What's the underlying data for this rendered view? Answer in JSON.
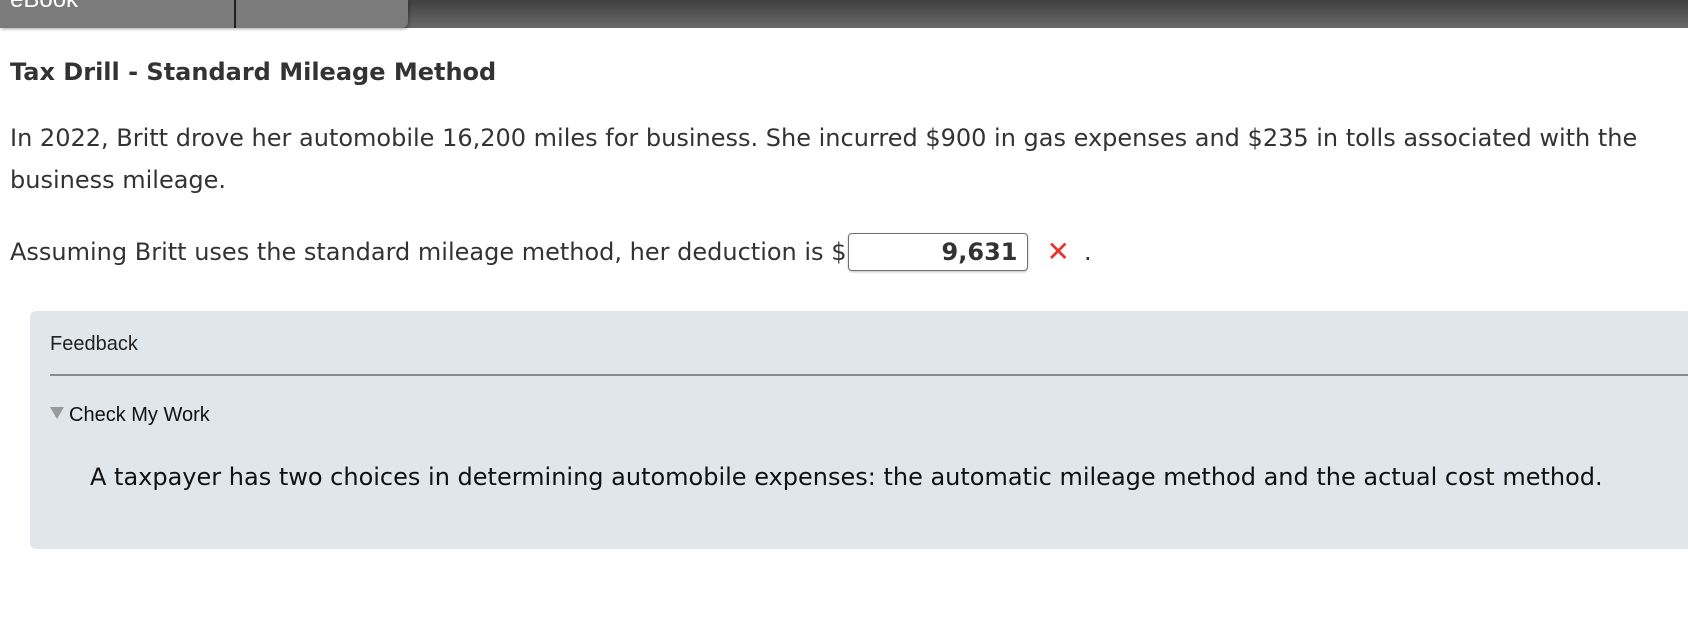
{
  "header": {
    "ebook_label": "eBook"
  },
  "problem": {
    "title": "Tax Drill - Standard Mileage Method",
    "text": "In 2022, Britt drove her automobile 16,200 miles for business. She incurred $900 in gas expenses and $235 in tolls associated with the business mileage.",
    "question_prefix": "Assuming Britt uses the standard mileage method, her deduction is $",
    "answer_value": "9,631",
    "result_mark": "✕",
    "result_status": "incorrect",
    "question_suffix": "."
  },
  "feedback": {
    "header": "Feedback",
    "toggle_label": "Check My Work",
    "text": "A taxpayer has two choices in determining automobile expenses: the automatic mileage method and the actual cost method."
  },
  "colors": {
    "error_red": "#e8322d",
    "feedback_bg": "#e0e6e9",
    "topbar": "#555555"
  },
  "icons": {
    "result": "x-mark-icon",
    "toggle": "triangle-down-icon"
  }
}
